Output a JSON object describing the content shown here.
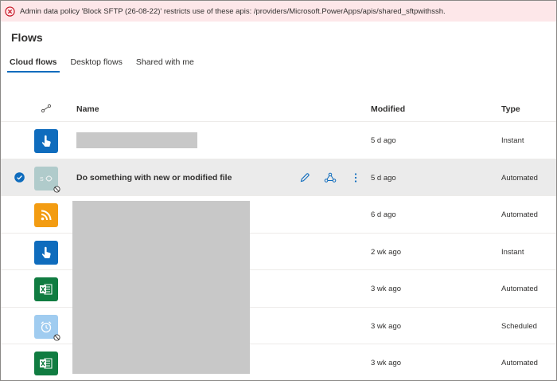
{
  "banner": {
    "message": "Admin data policy 'Block SFTP (26-08-22)' restricts use of these apis: /providers/Microsoft.PowerApps/apis/shared_sftpwithssh.",
    "color": "#fde7e9"
  },
  "page": {
    "title": "Flows"
  },
  "tabs": [
    {
      "label": "Cloud flows",
      "active": true
    },
    {
      "label": "Desktop flows",
      "active": false
    },
    {
      "label": "Shared with me",
      "active": false
    }
  ],
  "table": {
    "headers": {
      "name": "Name",
      "modified": "Modified",
      "type": "Type"
    },
    "rows": [
      {
        "icon": "touch-icon",
        "icon_bg": "#0f6cbd",
        "name": "",
        "modified": "5 d ago",
        "type": "Instant",
        "blocked": false,
        "selected": false
      },
      {
        "icon": "sftp-icon",
        "icon_bg": "#6aa6a6",
        "name": "Do something with new or modified file",
        "modified": "5 d ago",
        "type": "Automated",
        "blocked": true,
        "selected": true
      },
      {
        "icon": "rss-icon",
        "icon_bg": "#f39c12",
        "name": "",
        "modified": "6 d ago",
        "type": "Automated",
        "blocked": false,
        "selected": false
      },
      {
        "icon": "touch-icon",
        "icon_bg": "#0f6cbd",
        "name": "",
        "modified": "2 wk ago",
        "type": "Instant",
        "blocked": false,
        "selected": false
      },
      {
        "icon": "excel-icon",
        "icon_bg": "#107c41",
        "name": "",
        "modified": "3 wk ago",
        "type": "Automated",
        "blocked": false,
        "selected": false
      },
      {
        "icon": "alarm-clock-icon",
        "icon_bg": "#2f8fde",
        "name": "",
        "modified": "3 wk ago",
        "type": "Scheduled",
        "blocked": true,
        "selected": false
      },
      {
        "icon": "excel-icon",
        "icon_bg": "#107c41",
        "name": "",
        "modified": "3 wk ago",
        "type": "Automated",
        "blocked": false,
        "selected": false
      }
    ]
  },
  "colors": {
    "accent": "#0f6cbd",
    "error": "#c50f1f",
    "selected_row": "#ebebeb"
  }
}
